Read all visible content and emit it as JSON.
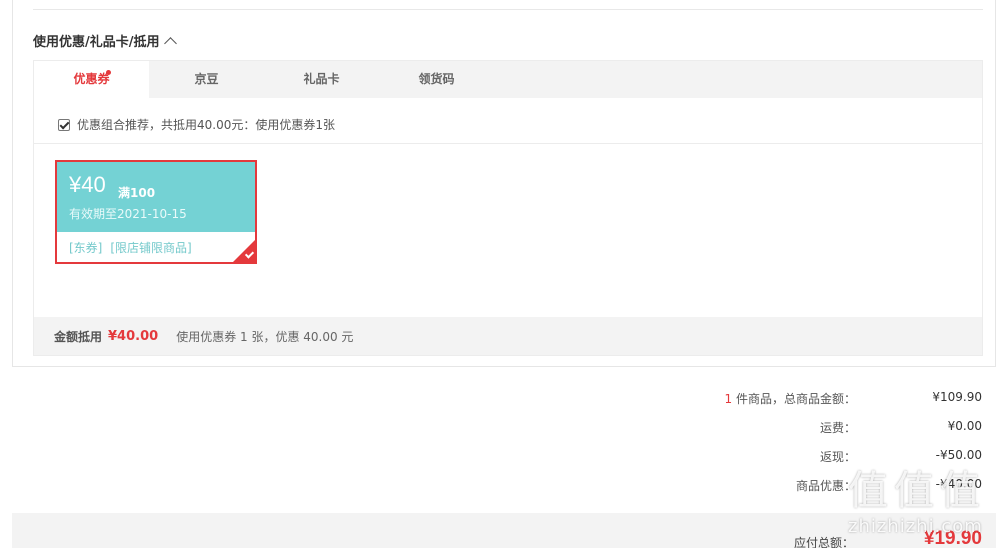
{
  "section": {
    "title": "使用优惠/礼品卡/抵用"
  },
  "tabs": [
    {
      "label": "优惠券",
      "active": true,
      "has_dot": true
    },
    {
      "label": "京豆",
      "active": false
    },
    {
      "label": "礼品卡",
      "active": false
    },
    {
      "label": "领货码",
      "active": false
    }
  ],
  "recommend": {
    "checked": true,
    "text": "优惠组合推荐，共抵用40.00元：使用优惠券1张"
  },
  "coupon": {
    "amount": "¥40",
    "limit": "满100",
    "validity": "有效期至2021-10-15",
    "tags": [
      "[东券]",
      "[限店铺限商品]"
    ],
    "selected": true,
    "color": "#74d2d4"
  },
  "summary": {
    "label": "金额抵用",
    "amount": "¥40.00",
    "detail": "使用优惠券 1 张，优惠 40.00 元"
  },
  "totals": {
    "count": "1",
    "items_label": " 件商品，总商品金额：",
    "items_value": "¥109.90",
    "shipping_label": "运费：",
    "shipping_value": "¥0.00",
    "cashback_label": "返现：",
    "cashback_value": "-¥50.00",
    "discount_label": "商品优惠：",
    "discount_value": "-¥40.00"
  },
  "payable": {
    "label": "应付总额：",
    "amount": "¥19.90"
  },
  "watermark": {
    "glyphs": [
      "值",
      "值",
      "值"
    ],
    "text": "zhizhizhi.com"
  },
  "colors": {
    "accent": "#e4393c",
    "coupon_bg": "#74d2d4"
  }
}
